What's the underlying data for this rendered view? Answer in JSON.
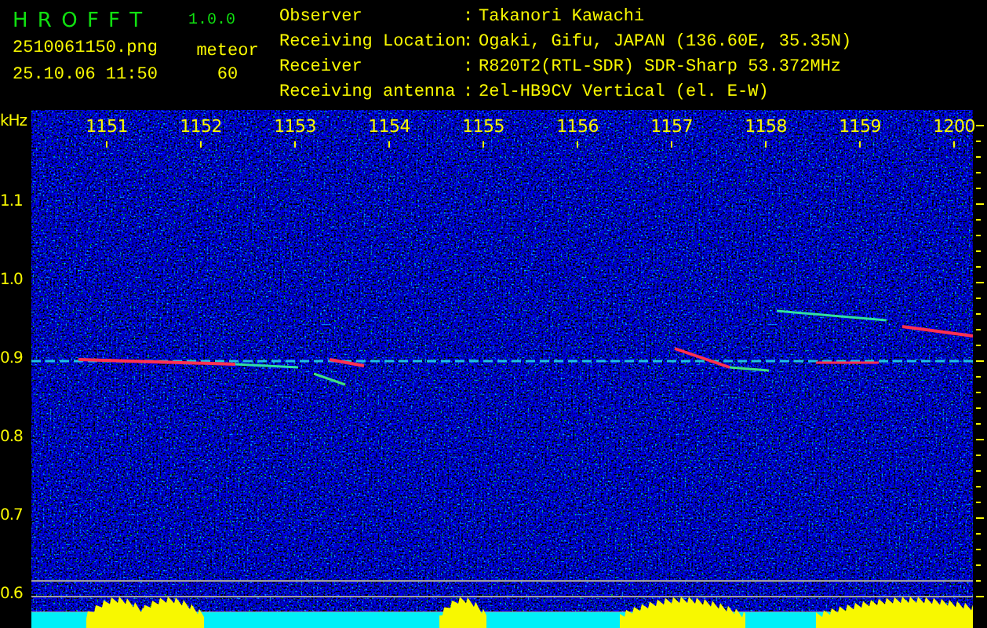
{
  "header": {
    "app_name": "H R O F F T",
    "version": "1.0.0",
    "file_name": "2510061150.png",
    "mode": "meteor",
    "timestamp": "25.10.06 11:50",
    "count": "60"
  },
  "info": [
    {
      "label": "Observer",
      "separator": ":",
      "value": "Takanori Kawachi"
    },
    {
      "label": "Receiving Location",
      "separator": ":",
      "value": "Ogaki, Gifu, JAPAN (136.60E, 35.35N)"
    },
    {
      "label": "Receiver",
      "separator": ":",
      "value": "R820T2(RTL-SDR) SDR-Sharp 53.372MHz"
    },
    {
      "label": "Receiving antenna",
      "separator": ":",
      "value": "2el-HB9CV Vertical (el. E-W)"
    }
  ],
  "spectrogram": {
    "y_unit": "kHz",
    "y_labels": [
      "1.1",
      "1.0",
      "0.9",
      "0.8",
      "0.7",
      "0.6"
    ],
    "time_labels": [
      "1151",
      "1152",
      "1153",
      "1154",
      "1155",
      "1156",
      "1157",
      "1158",
      "1159",
      "1200"
    ]
  }
}
